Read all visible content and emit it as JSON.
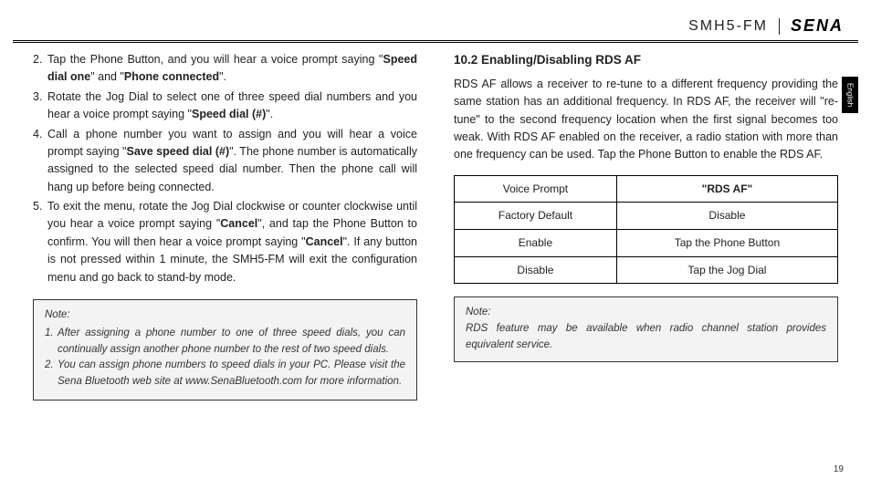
{
  "header": {
    "model": "SMH5-FM",
    "logo": "SENA",
    "lang_tab": "English"
  },
  "left": {
    "items": [
      {
        "num": "2.",
        "pre": "Tap the Phone Button, and you will hear a voice prompt saying \"",
        "b1": "Speed dial one",
        "mid": "\" and \"",
        "b2": "Phone connected",
        "post": "\"."
      },
      {
        "num": "3.",
        "pre": "Rotate the Jog Dial to select one of three speed dial numbers and you hear a voice prompt saying \"",
        "b1": "Speed dial (#)",
        "post": "\"."
      },
      {
        "num": "4.",
        "pre": "Call a phone number you want to assign and you will hear a voice prompt saying \"",
        "b1": "Save speed dial (#)",
        "post": "\". The phone number is automatically assigned to the selected speed dial number. Then the phone call will hang up before being connected."
      },
      {
        "num": "5.",
        "pre": "To exit the menu, rotate the Jog Dial clockwise or counter clockwise until you hear a voice prompt saying \"",
        "b1": "Cancel",
        "mid": "\", and tap the Phone Button to confirm. You will then hear a voice prompt saying \"",
        "b2": "Cancel",
        "post": "\". If any button is not pressed within 1 minute, the SMH5-FM will exit the configuration menu and go back to stand-by mode."
      }
    ],
    "note_title": "Note:",
    "note_items": [
      {
        "num": "1.",
        "text": "After assigning a phone number to one of three speed dials, you can continually assign another phone number to the rest of two speed dials."
      },
      {
        "num": "2.",
        "text": "You can assign phone numbers to speed dials in your PC. Please visit the Sena Bluetooth web site at www.SenaBluetooth.com for more information."
      }
    ]
  },
  "right": {
    "heading": "10.2  Enabling/Disabling RDS AF",
    "para": "RDS AF allows a receiver to re-tune to a different frequency providing the same station has an additional frequency. In RDS AF, the receiver will \"re-tune\" to the second frequency location when the first signal becomes too weak. With RDS AF enabled on the receiver, a radio station with more than one frequency can be used. Tap the Phone Button to enable the RDS AF.",
    "table": {
      "r1c1": "Voice Prompt",
      "r1c2": "\"RDS AF\"",
      "r2c1": "Factory Default",
      "r2c2": "Disable",
      "r3c1": "Enable",
      "r3c2": "Tap the Phone Button",
      "r4c1": "Disable",
      "r4c2": "Tap the Jog Dial"
    },
    "note2_title": "Note:",
    "note2_text": "RDS feature may be available when radio channel station provides equivalent service."
  },
  "page_number": "19"
}
